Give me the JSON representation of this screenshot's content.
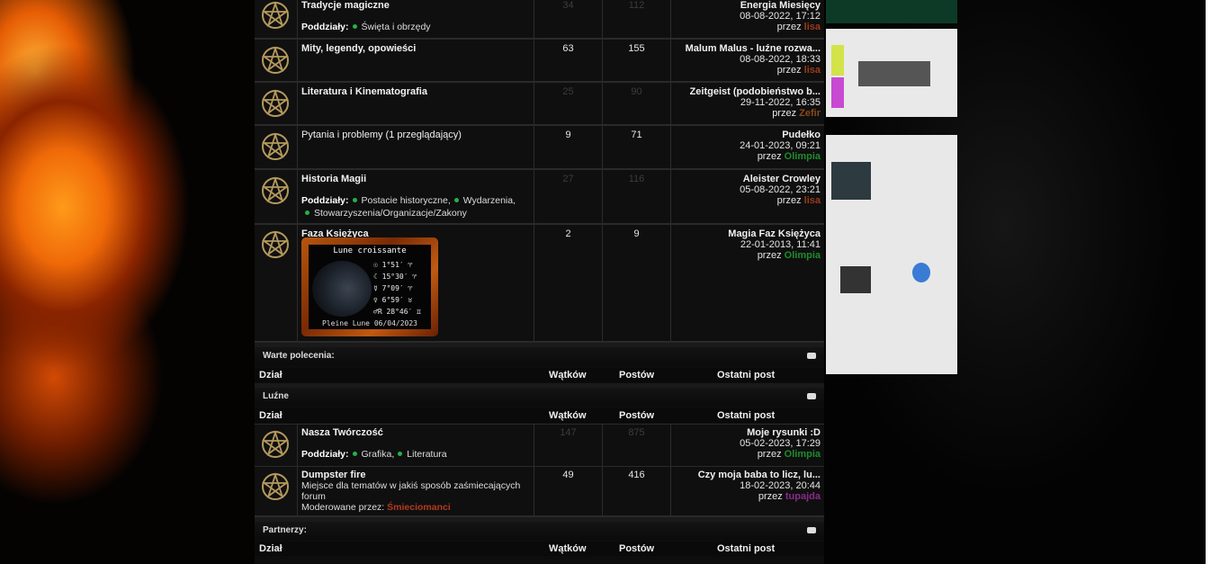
{
  "forums_top": [
    {
      "title": "Tradycje magiczne",
      "topics": "34",
      "posts": "112",
      "dim": true,
      "subforums_label": "Poddziały:",
      "subforums": [
        "Święta i obrzędy"
      ],
      "last": {
        "title": "Energia Miesięcy",
        "date": "08-08-2022, 17:12",
        "by_label": "przez",
        "user": "lisa",
        "user_class": "u-lisa"
      }
    },
    {
      "title": "Mity, legendy, opowieści",
      "topics": "63",
      "posts": "155",
      "dim": false,
      "last": {
        "title": "Malum Malus - luźne rozwa...",
        "date": "08-08-2022, 18:33",
        "by_label": "przez",
        "user": "lisa",
        "user_class": "u-lisa"
      }
    },
    {
      "title": "Literatura i Kinematografia",
      "topics": "25",
      "posts": "90",
      "dim": true,
      "last": {
        "title": "Zeitgeist (podobieństwo b...",
        "date": "29-11-2022, 16:35",
        "by_label": "przez",
        "user": "Zefir",
        "user_class": "u-zefir"
      }
    },
    {
      "title": "Pytania i problemy (1 przeglądający)",
      "topics": "9",
      "posts": "71",
      "dim": false,
      "last": {
        "title": "Pudełko",
        "date": "24-01-2023, 09:21",
        "by_label": "przez",
        "user": "Olimpia",
        "user_class": "u-olimpia"
      }
    },
    {
      "title": "Historia Magii",
      "topics": "27",
      "posts": "116",
      "dim": true,
      "subforums_label": "Poddziały:",
      "subforums": [
        "Postacie historyczne",
        "Wydarzenia",
        "Stowarzyszenia/Organizacje/Zakony"
      ],
      "last": {
        "title": "Aleister Crowley",
        "date": "05-08-2022, 23:21",
        "by_label": "przez",
        "user": "lisa",
        "user_class": "u-lisa"
      }
    },
    {
      "title": "Faza Księżyca",
      "topics": "2",
      "posts": "9",
      "dim": false,
      "last": {
        "title": "Magia Faz Księżyca",
        "date": "22-01-2013, 11:41",
        "by_label": "przez",
        "user": "Olimpia",
        "user_class": "u-olimpia"
      }
    }
  ],
  "moon_widget": {
    "title": "Lune croissante",
    "rows": [
      "☉  1°51′ ♈",
      "☾ 15°30′ ♈",
      "☿  7°09′ ♈",
      "♀  6°59′ ♉",
      "♂R 28°46′ ♊"
    ],
    "footer": "Pleine Lune 06/04/2023"
  },
  "columns": {
    "forum": "Dział",
    "topics": "Wątków",
    "posts": "Postów",
    "last": "Ostatni post"
  },
  "category_warte": {
    "name": "Warte polecenia:"
  },
  "category_luzne": {
    "name": "Luźne"
  },
  "category_partnerzy": {
    "name": "Partnerzy:"
  },
  "forums_luzne": [
    {
      "title": "Nasza Twórczość",
      "topics": "147",
      "posts": "875",
      "dim": true,
      "subforums_label": "Poddziały:",
      "subforums": [
        "Grafika",
        "Literatura"
      ],
      "last": {
        "title": "Moje rysunki :D",
        "date": "05-02-2023, 17:29",
        "by_label": "przez",
        "user": "Olimpia",
        "user_class": "u-olimpia"
      }
    },
    {
      "title": "Dumpster fire",
      "topics": "49",
      "posts": "416",
      "dim": false,
      "description": "Miejsce dla tematów w jakiś sposób zaśmiecających forum",
      "moderated_label": "Moderowane przez:",
      "moderators": "Śmieciomanci",
      "last": {
        "title": "Czy moja baba to licz, lu...",
        "date": "18-02-2023, 20:44",
        "by_label": "przez",
        "user": "tupajda",
        "user_class": "u-tupajda"
      }
    }
  ]
}
